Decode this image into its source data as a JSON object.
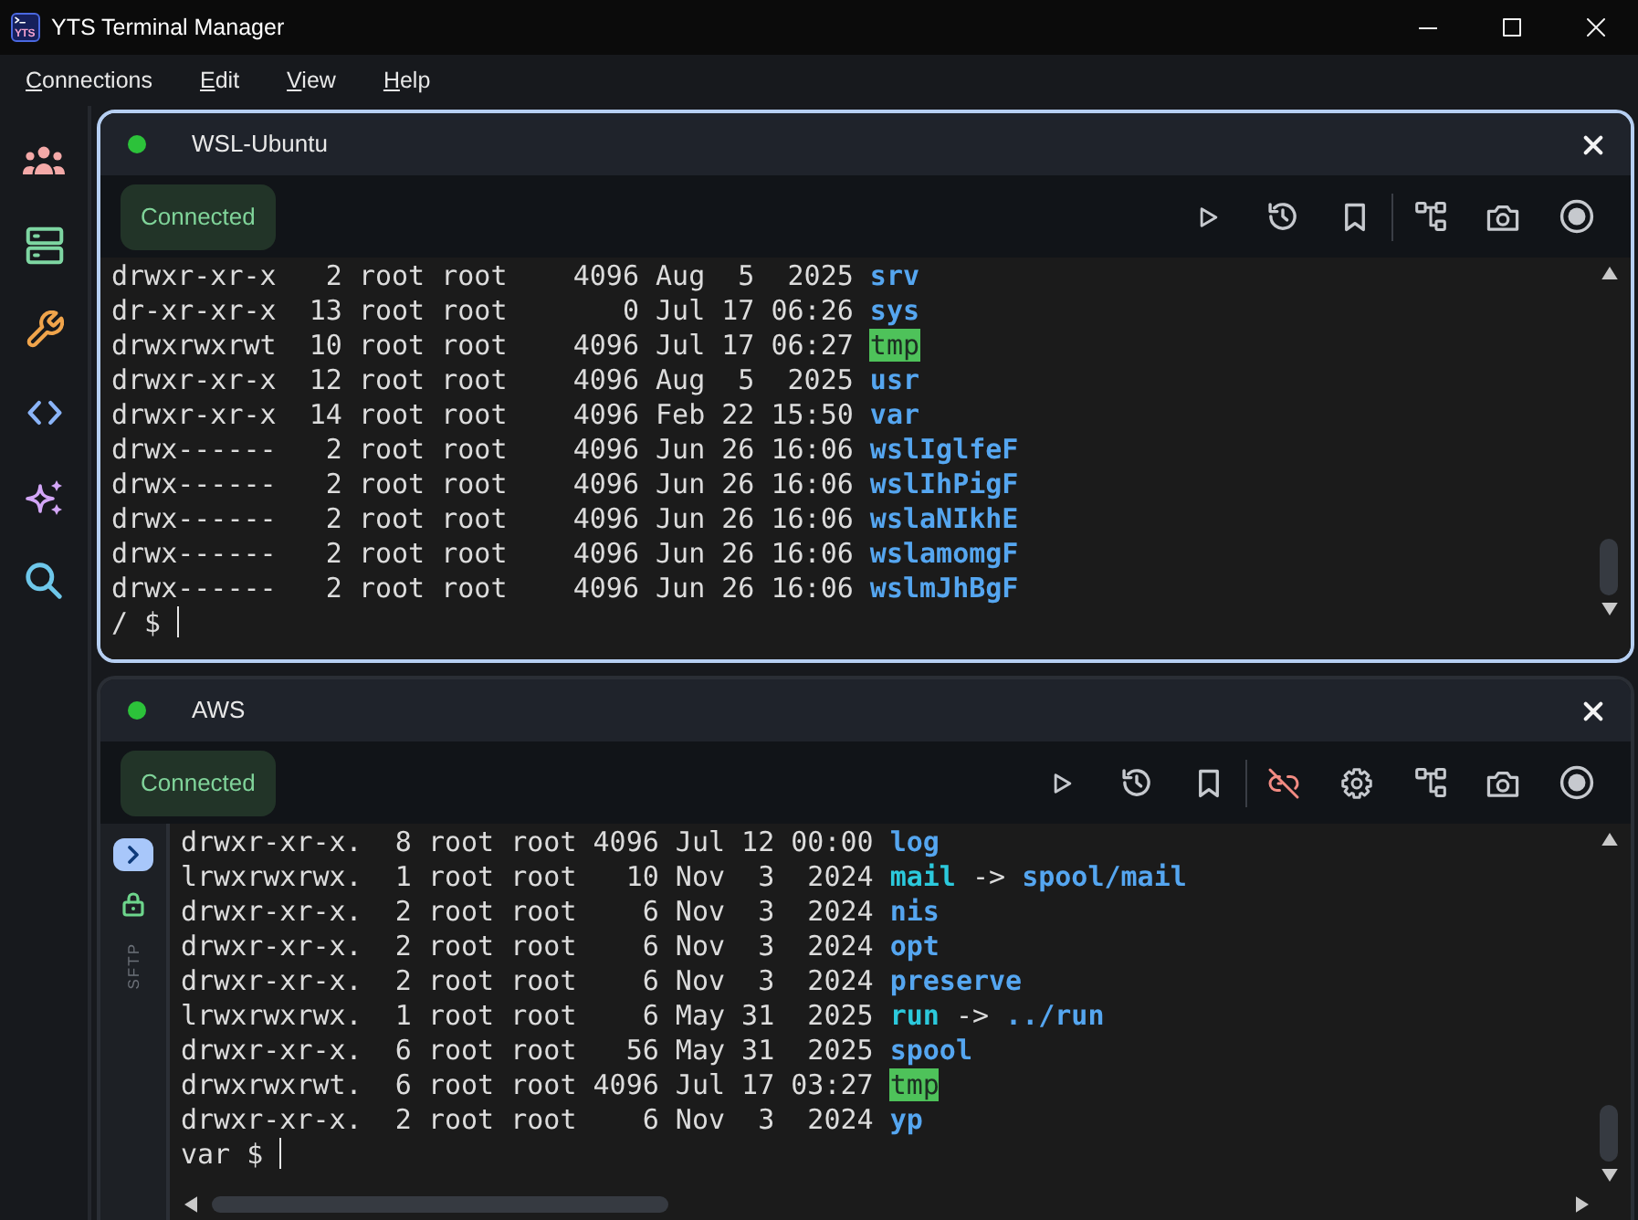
{
  "window": {
    "title": "YTS Terminal Manager",
    "logo_text": "YTS"
  },
  "menu": [
    {
      "label": "Connections"
    },
    {
      "label": "Edit"
    },
    {
      "label": "View"
    },
    {
      "label": "Help"
    }
  ],
  "panels": [
    {
      "title": "WSL-Ubuntu",
      "focused": true,
      "connected": true,
      "status": "Connected",
      "toolbar": [
        {
          "kind": "run"
        },
        {
          "kind": "history"
        },
        {
          "kind": "bookmark"
        },
        {
          "kind": "separator"
        },
        {
          "kind": "topology"
        },
        {
          "kind": "screenshot"
        },
        {
          "kind": "record"
        }
      ],
      "h_scrollbar": false,
      "lines": [
        {
          "info": "drwxr-xr-x   2 root root    4096 Aug  5  2025",
          "name": "srv",
          "kind": "dir"
        },
        {
          "info": "dr-xr-xr-x  13 root root       0 Jul 17 06:26",
          "name": "sys",
          "kind": "dir"
        },
        {
          "info": "drwxrwxrwt  10 root root    4096 Jul 17 06:27",
          "name": "tmp",
          "kind": "sticky"
        },
        {
          "info": "drwxr-xr-x  12 root root    4096 Aug  5  2025",
          "name": "usr",
          "kind": "dir"
        },
        {
          "info": "drwxr-xr-x  14 root root    4096 Feb 22 15:50",
          "name": "var",
          "kind": "dir"
        },
        {
          "info": "drwx------   2 root root    4096 Jun 26 16:06",
          "name": "wslIglfeF",
          "kind": "dir"
        },
        {
          "info": "drwx------   2 root root    4096 Jun 26 16:06",
          "name": "wslIhPigF",
          "kind": "dir"
        },
        {
          "info": "drwx------   2 root root    4096 Jun 26 16:06",
          "name": "wslaNIkhE",
          "kind": "dir"
        },
        {
          "info": "drwx------   2 root root    4096 Jun 26 16:06",
          "name": "wslamomgF",
          "kind": "dir"
        },
        {
          "info": "drwx------   2 root root    4096 Jun 26 16:06",
          "name": "wslmJhBgF",
          "kind": "dir"
        }
      ],
      "prompt": "/ $"
    },
    {
      "title": "AWS",
      "focused": false,
      "connected": true,
      "status": "Connected",
      "toolbar": [
        {
          "kind": "run"
        },
        {
          "kind": "history"
        },
        {
          "kind": "bookmark"
        },
        {
          "kind": "separator"
        },
        {
          "kind": "disconnect"
        },
        {
          "kind": "settings"
        },
        {
          "kind": "topology"
        },
        {
          "kind": "screenshot"
        },
        {
          "kind": "record"
        }
      ],
      "sftp": {
        "label": "SFTP"
      },
      "h_scrollbar": true,
      "lines": [
        {
          "info": "drwxr-xr-x.  8 root root 4096 Jul 12 00:00",
          "name": "log",
          "kind": "dir"
        },
        {
          "info": "lrwxrwxrwx.  1 root root   10 Nov  3  2024",
          "name": "mail",
          "kind": "link",
          "arrow": "->",
          "target": "spool/mail"
        },
        {
          "info": "drwxr-xr-x.  2 root root    6 Nov  3  2024",
          "name": "nis",
          "kind": "dir"
        },
        {
          "info": "drwxr-xr-x.  2 root root    6 Nov  3  2024",
          "name": "opt",
          "kind": "dir"
        },
        {
          "info": "drwxr-xr-x.  2 root root    6 Nov  3  2024",
          "name": "preserve",
          "kind": "dir"
        },
        {
          "info": "lrwxrwxrwx.  1 root root    6 May 31  2025",
          "name": "run",
          "kind": "link",
          "arrow": "->",
          "target": "../run"
        },
        {
          "info": "drwxr-xr-x.  6 root root   56 May 31  2025",
          "name": "spool",
          "kind": "dir"
        },
        {
          "info": "drwxrwxrwt.  6 root root 4096 Jul 17 03:27",
          "name": "tmp",
          "kind": "sticky"
        },
        {
          "info": "drwxr-xr-x.  2 root root    6 Nov  3  2024",
          "name": "yp",
          "kind": "dir"
        }
      ],
      "prompt": "var $"
    }
  ]
}
